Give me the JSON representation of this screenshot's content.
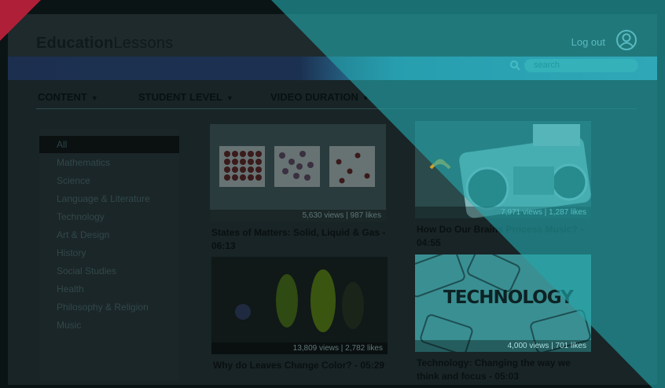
{
  "header": {
    "logo_bold": "Education",
    "logo_light": "Lessons",
    "logout_label": "Log out",
    "search_placeholder": "search"
  },
  "filters": [
    {
      "label": "CONTENT"
    },
    {
      "label": "STUDENT LEVEL"
    },
    {
      "label": "VIDEO DURATION"
    }
  ],
  "sidebar": {
    "items": [
      {
        "label": "All"
      },
      {
        "label": "Mathematics"
      },
      {
        "label": "Science"
      },
      {
        "label": "Language & Literature"
      },
      {
        "label": "Technology"
      },
      {
        "label": "Art & Design"
      },
      {
        "label": "History"
      },
      {
        "label": "Social Studies"
      },
      {
        "label": "Health"
      },
      {
        "label": "Philosophy & Religion"
      },
      {
        "label": "Music"
      }
    ],
    "active_index": 0
  },
  "videos": [
    {
      "title": "States of Matters: Solid, Liquid & Gas - 06:13",
      "stats": "5,630 views  |  987 likes"
    },
    {
      "title": "How Do Our Brains Process Music? - 04:55",
      "stats": "7,971 views  |  1,287 likes"
    },
    {
      "title": "Why do Leaves Change Color? - 05:29",
      "stats": "13,809 views  |  2,782 likes"
    },
    {
      "title": "Technology: Changing the way we think and focus - 05:03",
      "stats": "4,000 views  |  701 likes",
      "thumb_text": "TECHNOLOGY"
    }
  ],
  "colors": {
    "overlay_teal": "#24a8ac",
    "corner_red": "#b01f38"
  }
}
